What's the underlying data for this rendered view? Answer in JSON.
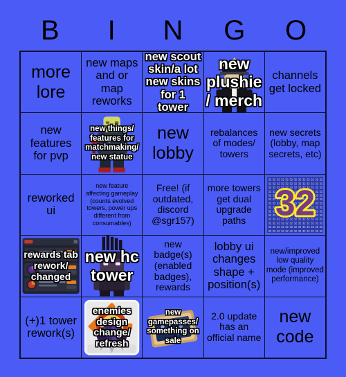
{
  "card": {
    "title": "BINGO",
    "background_color": "#4a5cf5",
    "text_color": "#000000",
    "grid_line_color": "#10102a",
    "outline_text_color": "#ffffff"
  },
  "header": {
    "letters": [
      {
        "label": "B"
      },
      {
        "label": "I"
      },
      {
        "label": "N"
      },
      {
        "label": "G"
      },
      {
        "label": "O"
      }
    ]
  },
  "grid": {
    "rows": 5,
    "columns": 5,
    "cells": [
      {
        "id": "b1",
        "text": "more lore",
        "size": "xl",
        "style": "plain",
        "art": "none"
      },
      {
        "id": "i1",
        "text": "new maps and or map reworks",
        "size": "lg",
        "style": "plain",
        "art": "none"
      },
      {
        "id": "n1",
        "text": "new scout skin/a lot new skins for 1 tower",
        "size": "lg",
        "style": "outlined",
        "art": "none"
      },
      {
        "id": "g1",
        "text": "new plushie/ merch",
        "size": "xl",
        "style": "outlined",
        "art": "crown-character"
      },
      {
        "id": "o1",
        "text": "channels get locked",
        "size": "lg",
        "style": "plain",
        "art": "none"
      },
      {
        "id": "b2",
        "text": "new features for pvp",
        "size": "lg",
        "style": "plain",
        "art": "none"
      },
      {
        "id": "i2",
        "text": "new things/ features for matchmaking/ new statue",
        "size": "sm",
        "style": "outlined",
        "art": "statue-character"
      },
      {
        "id": "n2",
        "text": "new lobby",
        "size": "xl",
        "style": "plain",
        "art": "none"
      },
      {
        "id": "g2",
        "text": "rebalances of modes/ towers",
        "size": "md",
        "style": "plain",
        "art": "none"
      },
      {
        "id": "o2",
        "text": "new secrets (lobby, map secrets, etc)",
        "size": "md",
        "style": "plain",
        "art": "none"
      },
      {
        "id": "b3",
        "text": "reworked ui",
        "size": "lg",
        "style": "plain",
        "art": "none"
      },
      {
        "id": "i3",
        "text": "new feature affecting gameplay (counts evolved towers, power ups different from consumables)",
        "size": "xs",
        "style": "plain",
        "art": "none"
      },
      {
        "id": "n3",
        "text": "Free! (if outdated, discord @sgr157)",
        "size": "md",
        "style": "plain",
        "art": "none"
      },
      {
        "id": "g3",
        "text": "more towers get dual upgrade paths",
        "size": "md",
        "style": "plain",
        "art": "none"
      },
      {
        "id": "o3",
        "text": "",
        "size": "md",
        "style": "plain",
        "art": "logo-32"
      },
      {
        "id": "b4",
        "text": "rewards tab rework/ changed",
        "size": "md",
        "style": "outlined",
        "art": "rewards-panel"
      },
      {
        "id": "i4",
        "text": "new hc tower",
        "size": "xl",
        "style": "outlined",
        "art": "hc-tower-character"
      },
      {
        "id": "n4",
        "text": "new badge(s) (enabled badges), rewards",
        "size": "md",
        "style": "plain",
        "art": "none"
      },
      {
        "id": "g4",
        "text": "lobby ui changes shape + position(s)",
        "size": "lg",
        "style": "plain",
        "art": "none"
      },
      {
        "id": "o4",
        "text": "new/improved low quality mode (improved performance)",
        "size": "sm",
        "style": "plain",
        "art": "none"
      },
      {
        "id": "b5",
        "text": "(+)1 tower rework(s)",
        "size": "lg",
        "style": "plain",
        "art": "none"
      },
      {
        "id": "i5",
        "text": "enemies design change/ refresh",
        "size": "md",
        "style": "outlined",
        "art": "badge-thumbnail"
      },
      {
        "id": "n5",
        "text": "new gamepasses/ something on sale",
        "size": "sm",
        "style": "outlined",
        "art": "gamepass-card"
      },
      {
        "id": "g5",
        "text": "2.0 update has an official name",
        "size": "md",
        "style": "plain",
        "art": "none"
      },
      {
        "id": "o5",
        "text": "new code",
        "size": "xl",
        "style": "plain",
        "art": "none"
      }
    ]
  },
  "artwork": {
    "logo_32": {
      "label": "32",
      "outline_color": "#ffe92b",
      "fill_color": "#b05ab8",
      "shadow_color": "#1a0a2a",
      "tile_text": "32"
    }
  }
}
